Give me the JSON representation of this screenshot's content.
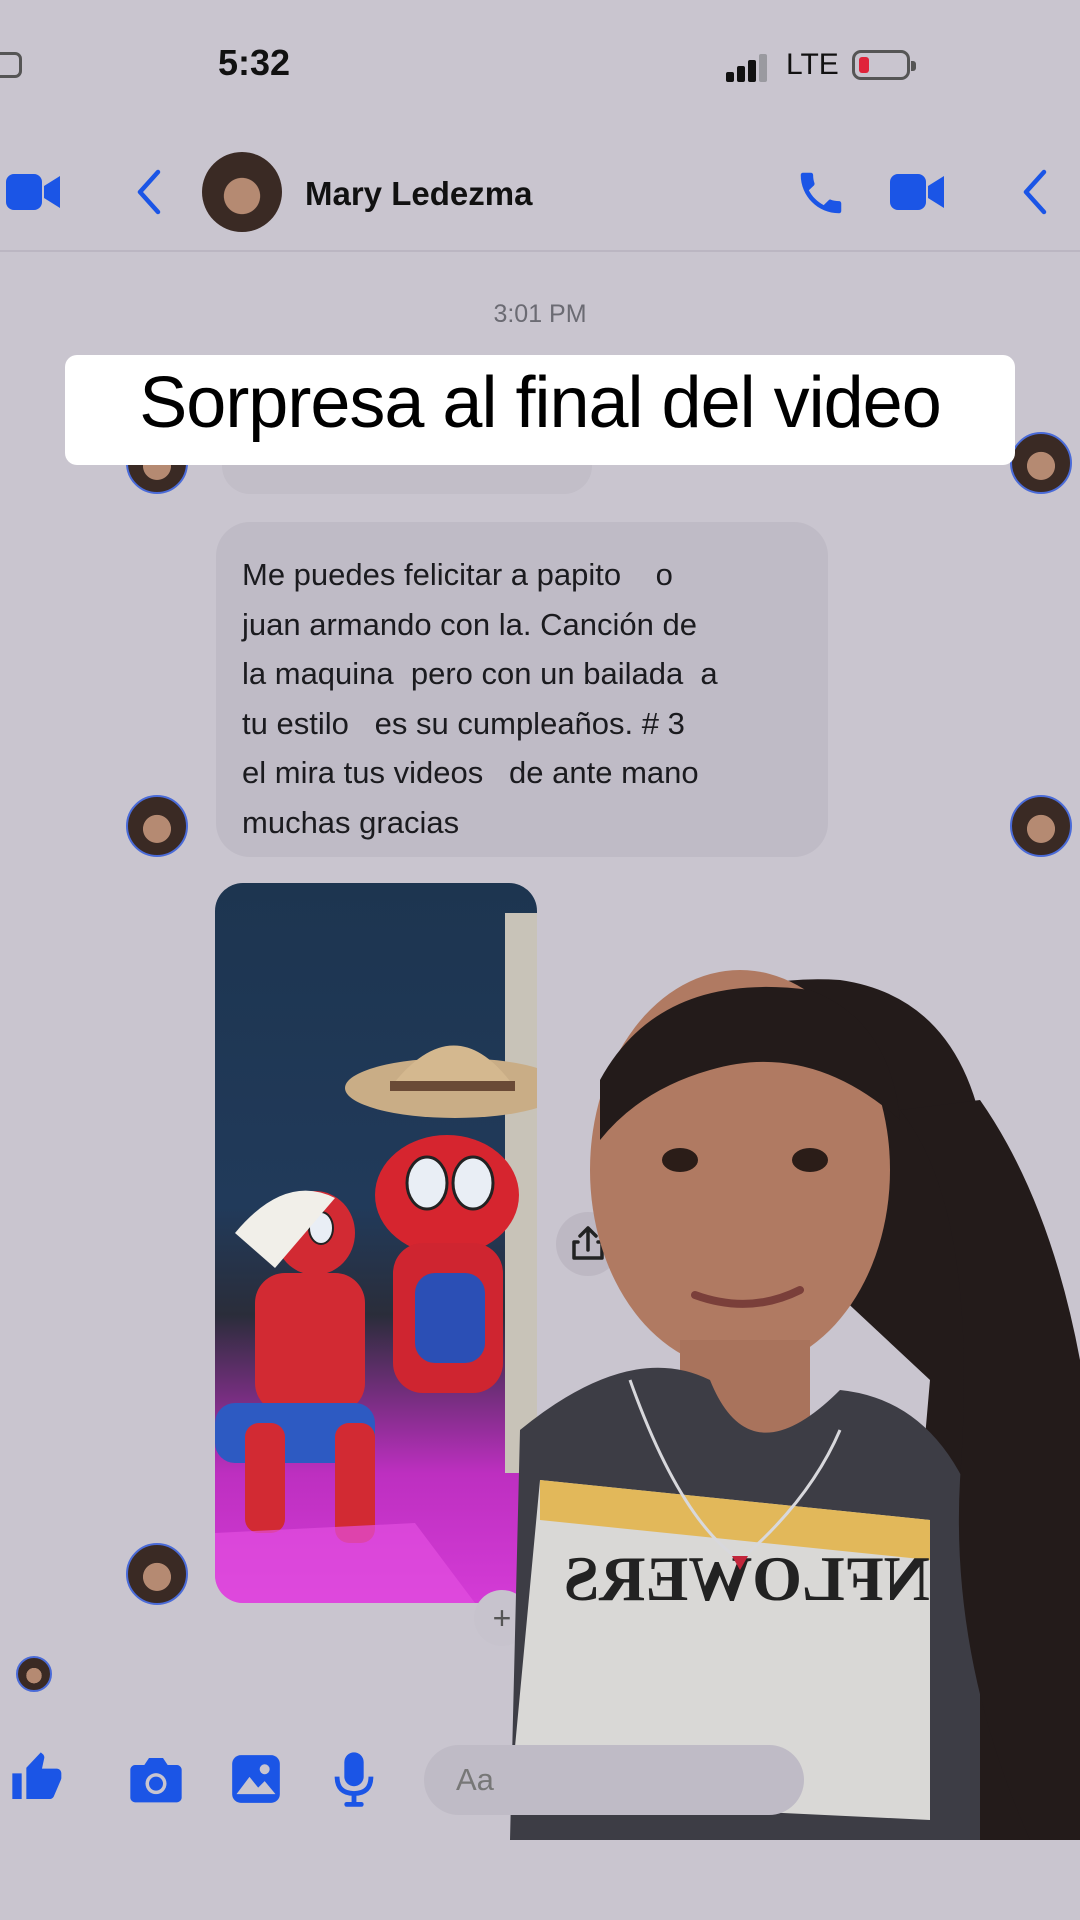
{
  "status_bar": {
    "time": "5:32",
    "network": "LTE"
  },
  "header": {
    "contact_name": "Mary Ledezma",
    "icons": [
      "video-camera-icon",
      "back-chevron-icon",
      "phone-icon",
      "video-camera-icon",
      "back-chevron-icon"
    ]
  },
  "chat": {
    "timestamp": "3:01 PM",
    "message": "Me puedes felicitar a papito    o\njuan armando con la. Canción de\nla maquina  pero con un bailada  a\ntu estilo   es su cumpleaños. # 3\nel mira tus videos   de ante mano\nmuchas gracias"
  },
  "overlay": {
    "caption": "Sorpresa al final del video"
  },
  "composer": {
    "placeholder": "Aa"
  },
  "colors": {
    "accent": "#1b55e6",
    "background": "#c9c5cf",
    "bubble": "#bfbbc6"
  }
}
